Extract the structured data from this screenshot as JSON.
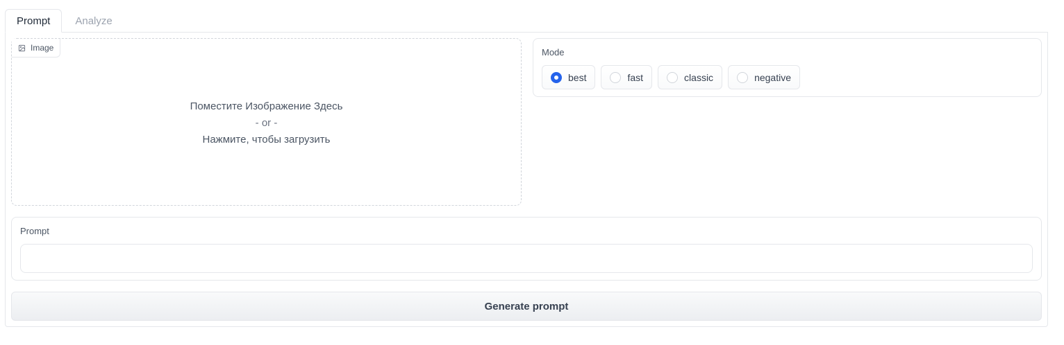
{
  "tabs": [
    {
      "label": "Prompt",
      "active": true
    },
    {
      "label": "Analyze",
      "active": false
    }
  ],
  "image_upload": {
    "label": "Image",
    "drop_text": "Поместите Изображение Здесь",
    "or_text": "- or -",
    "click_text": "Нажмите, чтобы загрузить"
  },
  "mode": {
    "label": "Mode",
    "options": [
      {
        "label": "best",
        "selected": true
      },
      {
        "label": "fast",
        "selected": false
      },
      {
        "label": "classic",
        "selected": false
      },
      {
        "label": "negative",
        "selected": false
      }
    ]
  },
  "prompt": {
    "label": "Prompt",
    "value": ""
  },
  "generate_button": {
    "label": "Generate prompt"
  },
  "colors": {
    "accent": "#2563eb",
    "border": "#e5e7eb"
  }
}
